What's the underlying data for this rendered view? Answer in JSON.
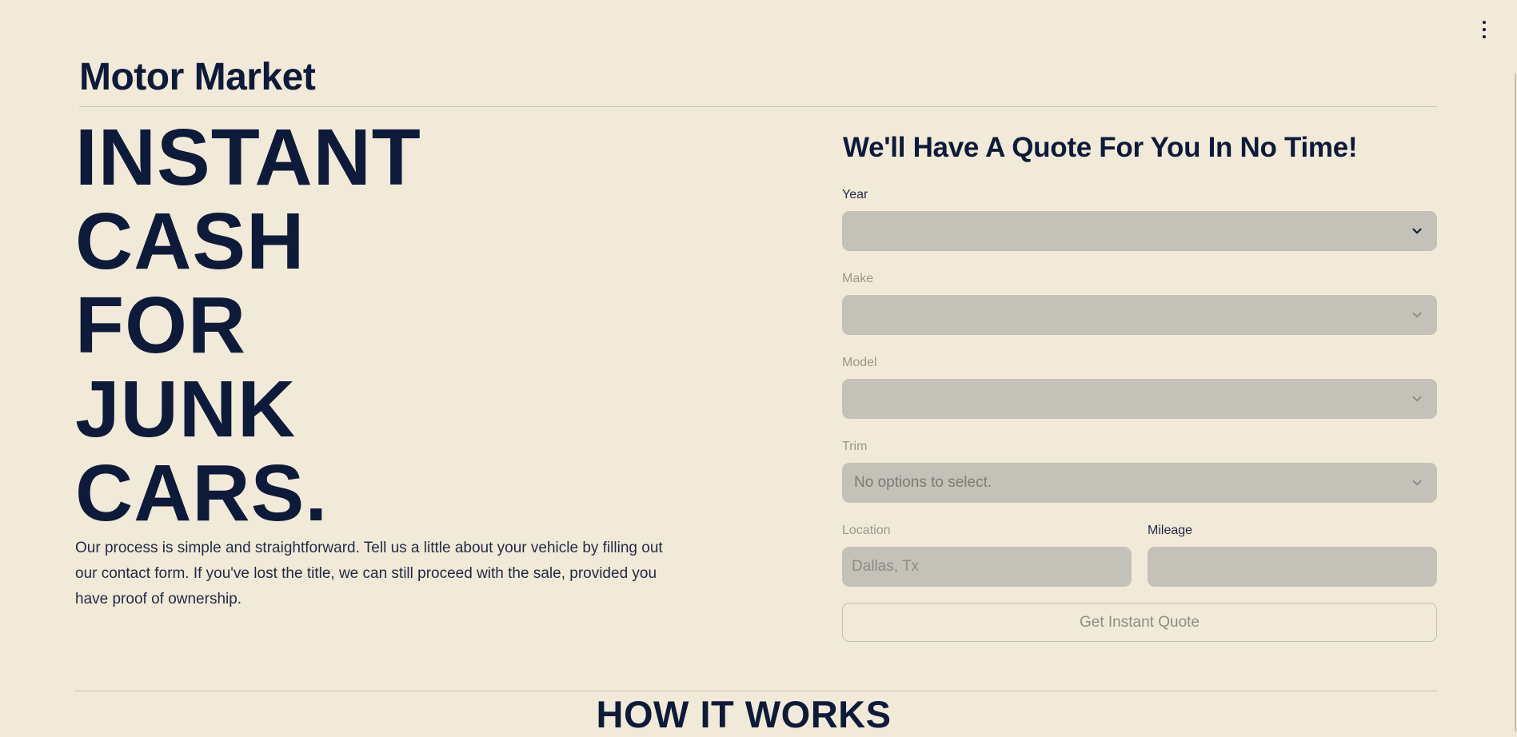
{
  "brand": {
    "title": "Motor Market"
  },
  "hero": {
    "lines": [
      "INSTANT",
      "CASH",
      "FOR",
      "JUNK",
      "CARS."
    ]
  },
  "intro": {
    "text": "Our process is simple and straightforward. Tell us a little about your vehicle by filling out our contact form. If you've lost the title, we can still proceed with the sale, provided you have proof of ownership."
  },
  "form": {
    "title": "We'll Have A Quote For You In No Time!",
    "year": {
      "label": "Year",
      "value": ""
    },
    "make": {
      "label": "Make",
      "value": ""
    },
    "model": {
      "label": "Model",
      "value": ""
    },
    "trim": {
      "label": "Trim",
      "value": "No options to select."
    },
    "location": {
      "label": "Location",
      "placeholder": "Dallas, Tx",
      "value": ""
    },
    "mileage": {
      "label": "Mileage",
      "placeholder": "",
      "value": ""
    },
    "submit_label": "Get Instant Quote"
  },
  "section": {
    "how_it_works": "HOW IT WORKS"
  },
  "icons": {
    "menu": "more-vertical-icon",
    "dropdown": "chevron-down-icon"
  },
  "colors": {
    "background": "#f2ead8",
    "text": "#0e1a3a",
    "input": "#c4c1b8",
    "muted": "#9b978c"
  }
}
